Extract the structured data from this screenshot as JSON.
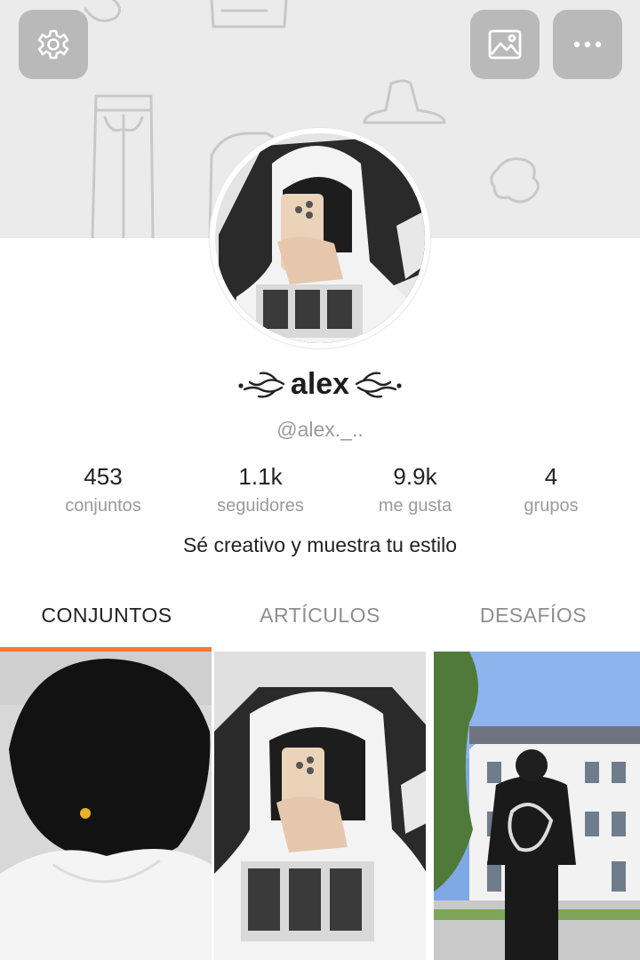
{
  "header": {
    "settings_icon": "gear-icon",
    "background_icon": "image-icon",
    "more_icon": "more-horizontal-icon",
    "button_color": "#b9b9b9"
  },
  "profile": {
    "display_name": "alex",
    "username": "@alex._..",
    "bio": "Sé creativo y muestra tu estilo"
  },
  "stats": [
    {
      "value": "453",
      "label": "conjuntos"
    },
    {
      "value": "1.1k",
      "label": "seguidores"
    },
    {
      "value": "9.9k",
      "label": "me gusta"
    },
    {
      "value": "4",
      "label": "grupos"
    }
  ],
  "tabs": [
    {
      "label": "CONJUNTOS",
      "active": true
    },
    {
      "label": "ARTÍCULOS",
      "active": false
    },
    {
      "label": "DESAFÍOS",
      "active": false
    }
  ],
  "accent_color": "#f07a3c"
}
